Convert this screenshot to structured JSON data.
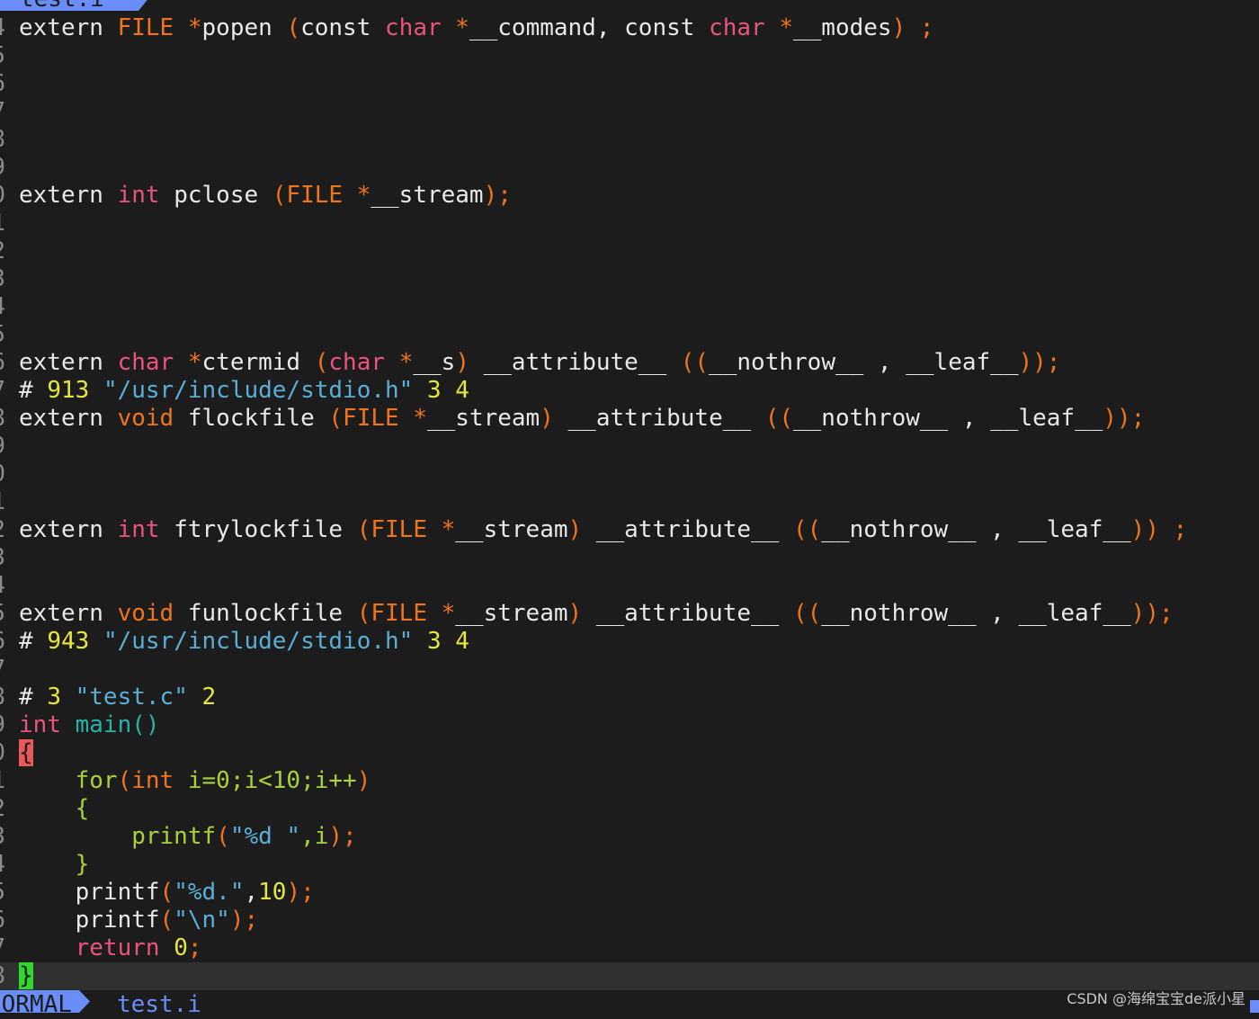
{
  "tabline": {
    "tab_label": "test.i"
  },
  "colors": {
    "background": "#1c1c1c",
    "accent": "#6b8df7",
    "keyword_orange": "#f0741c",
    "type_pink": "#e9557a",
    "number_yellow": "#e6e640",
    "string_blue": "#5aaed6",
    "function_teal": "#23b3a8",
    "cursorline": "#303030"
  },
  "editor": {
    "line_number_digits": [
      "4",
      "5",
      "6",
      "7",
      "8",
      "9",
      "0",
      "1",
      "2",
      "3",
      "4",
      "5",
      "6",
      "7",
      "8",
      "9",
      "0",
      "1",
      "2",
      "3",
      "4",
      "5",
      "6",
      "7",
      "8",
      "9",
      "0",
      "1",
      "2",
      "3",
      "4",
      "5",
      "6",
      "7",
      "8"
    ],
    "cursor_row": 34,
    "lines": {
      "0": [
        [
          "extern ",
          "w"
        ],
        [
          "FILE ",
          "o"
        ],
        [
          "*",
          "o"
        ],
        [
          "popen ",
          "w"
        ],
        [
          "(",
          "o"
        ],
        [
          "const ",
          "w"
        ],
        [
          "char ",
          "p"
        ],
        [
          "*",
          "o"
        ],
        [
          "__command, const ",
          "w"
        ],
        [
          "char ",
          "p"
        ],
        [
          "*",
          "o"
        ],
        [
          "__modes",
          "w"
        ],
        [
          ") ;",
          "o"
        ]
      ],
      "6": [
        [
          "extern ",
          "w"
        ],
        [
          "int ",
          "p"
        ],
        [
          "pclose ",
          "w"
        ],
        [
          "(FILE *",
          "o"
        ],
        [
          "__stream",
          "w"
        ],
        [
          ");",
          "o"
        ]
      ],
      "12": [
        [
          "extern ",
          "w"
        ],
        [
          "char ",
          "p"
        ],
        [
          "*",
          "o"
        ],
        [
          "ctermid ",
          "w"
        ],
        [
          "(",
          "o"
        ],
        [
          "char ",
          "p"
        ],
        [
          "*",
          "o"
        ],
        [
          "__s",
          "w"
        ],
        [
          ") ",
          "o"
        ],
        [
          "__attribute__ ",
          "w"
        ],
        [
          "((",
          "o"
        ],
        [
          "__nothrow__ , __leaf__",
          "w"
        ],
        [
          "));",
          "o"
        ]
      ],
      "13": [
        [
          "# ",
          "w"
        ],
        [
          "913 ",
          "y"
        ],
        [
          "\"/usr/include/stdio.h\" ",
          "b"
        ],
        [
          "3 4",
          "y"
        ]
      ],
      "14": [
        [
          "extern ",
          "w"
        ],
        [
          "void ",
          "o"
        ],
        [
          "flockfile ",
          "w"
        ],
        [
          "(FILE *",
          "o"
        ],
        [
          "__stream",
          "w"
        ],
        [
          ") ",
          "o"
        ],
        [
          "__attribute__ ",
          "w"
        ],
        [
          "((",
          "o"
        ],
        [
          "__nothrow__ , __leaf__",
          "w"
        ],
        [
          "));",
          "o"
        ]
      ],
      "18": [
        [
          "extern ",
          "w"
        ],
        [
          "int ",
          "p"
        ],
        [
          "ftrylockfile ",
          "w"
        ],
        [
          "(FILE *",
          "o"
        ],
        [
          "__stream",
          "w"
        ],
        [
          ") ",
          "o"
        ],
        [
          "__attribute__ ",
          "w"
        ],
        [
          "((",
          "o"
        ],
        [
          "__nothrow__ , __leaf__",
          "w"
        ],
        [
          ")) ;",
          "o"
        ]
      ],
      "21": [
        [
          "extern ",
          "w"
        ],
        [
          "void ",
          "o"
        ],
        [
          "funlockfile ",
          "w"
        ],
        [
          "(FILE *",
          "o"
        ],
        [
          "__stream",
          "w"
        ],
        [
          ") ",
          "o"
        ],
        [
          "__attribute__ ",
          "w"
        ],
        [
          "((",
          "o"
        ],
        [
          "__nothrow__ , __leaf__",
          "w"
        ],
        [
          "));",
          "o"
        ]
      ],
      "22": [
        [
          "# ",
          "w"
        ],
        [
          "943 ",
          "y"
        ],
        [
          "\"/usr/include/stdio.h\" ",
          "b"
        ],
        [
          "3 4",
          "y"
        ]
      ],
      "24": [
        [
          "# ",
          "w"
        ],
        [
          "3 ",
          "y"
        ],
        [
          "\"test.c\" ",
          "b"
        ],
        [
          "2",
          "y"
        ]
      ],
      "25": [
        [
          "int ",
          "p"
        ],
        [
          "main()",
          "t"
        ]
      ],
      "26": [
        [
          "{",
          "hlr"
        ]
      ],
      "27": [
        [
          "    for",
          "g"
        ],
        [
          "(int ",
          "o"
        ],
        [
          "i=0;i<10;i++",
          "g"
        ],
        [
          ")",
          "o"
        ]
      ],
      "28": [
        [
          "    {",
          "g"
        ]
      ],
      "29": [
        [
          "        printf",
          "g"
        ],
        [
          "(",
          "o"
        ],
        [
          "\"%d \"",
          "b"
        ],
        [
          ",i",
          "g"
        ],
        [
          ");",
          "o"
        ]
      ],
      "30": [
        [
          "    }",
          "g"
        ]
      ],
      "31": [
        [
          "    printf",
          "w"
        ],
        [
          "(",
          "o"
        ],
        [
          "\"%d.\"",
          "b"
        ],
        [
          ",",
          "w"
        ],
        [
          "10",
          "y"
        ],
        [
          ");",
          "o"
        ]
      ],
      "32": [
        [
          "    printf",
          "w"
        ],
        [
          "(",
          "o"
        ],
        [
          "\"\\n\"",
          "b"
        ],
        [
          ");",
          "o"
        ]
      ],
      "33": [
        [
          "    return ",
          "p"
        ],
        [
          "0",
          "y"
        ],
        [
          ";",
          "o"
        ]
      ],
      "34": [
        [
          "}",
          "hlg"
        ]
      ]
    }
  },
  "statusline": {
    "mode": "NORMAL",
    "filename": "test.i"
  },
  "watermark": "CSDN @海绵宝宝de派小星"
}
